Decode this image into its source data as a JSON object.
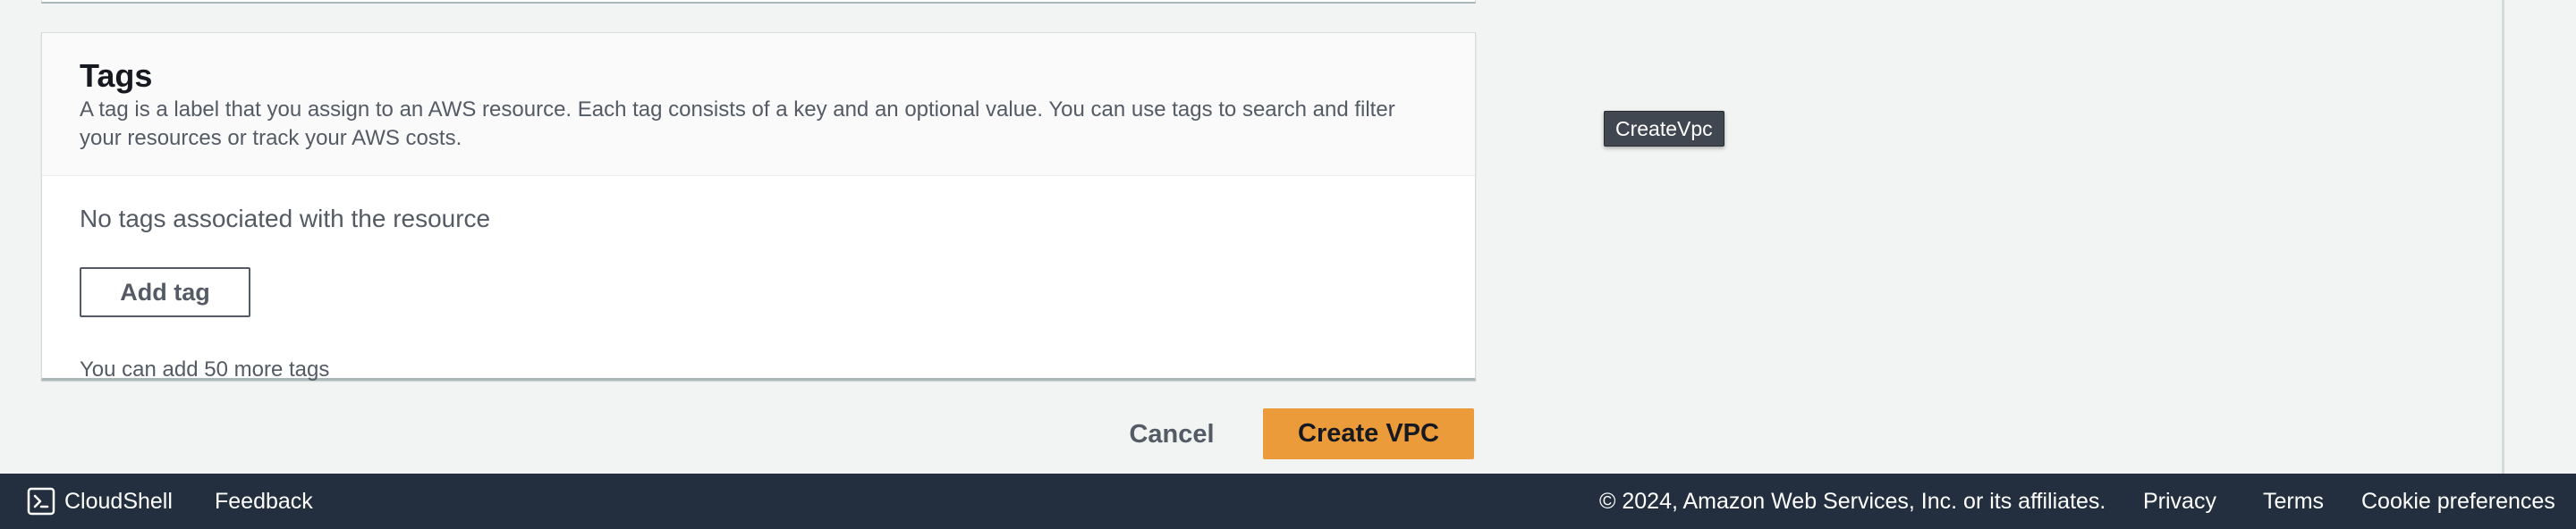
{
  "tags": {
    "title": "Tags",
    "description": "A tag is a label that you assign to an AWS resource. Each tag consists of a key and an optional value. You can use tags to search and filter your resources or track your AWS costs.",
    "empty_message": "No tags associated with the resource",
    "add_tag_label": "Add tag",
    "limit_message": "You can add 50 more tags"
  },
  "actions": {
    "cancel_label": "Cancel",
    "create_label": "Create VPC"
  },
  "tooltip": {
    "text": "CreateVpc"
  },
  "footer": {
    "cloudshell_label": "CloudShell",
    "feedback_label": "Feedback",
    "copyright": "© 2024, Amazon Web Services, Inc. or its affiliates.",
    "privacy_label": "Privacy",
    "terms_label": "Terms",
    "cookie_label": "Cookie preferences",
    "cloudshell_icon": "terminal-icon"
  },
  "colors": {
    "primary_button": "#ec9b3a",
    "footer_bg": "#232f3e",
    "page_bg": "#f2f3f3"
  }
}
